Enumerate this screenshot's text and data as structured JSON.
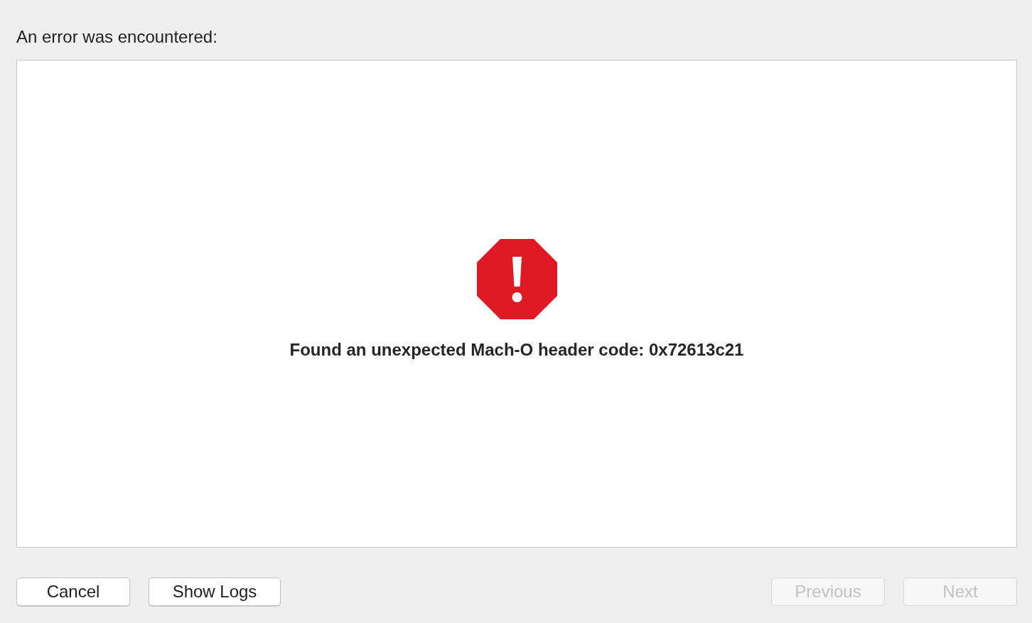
{
  "heading": "An error was encountered:",
  "error": {
    "message": "Found an unexpected Mach-O header code: 0x72613c21"
  },
  "left_buttons": [
    {
      "label": "Cancel",
      "disabled": false
    },
    {
      "label": "Show Logs",
      "disabled": false
    }
  ],
  "right_buttons": [
    {
      "label": "Previous",
      "disabled": true
    },
    {
      "label": "Next",
      "disabled": true
    }
  ]
}
